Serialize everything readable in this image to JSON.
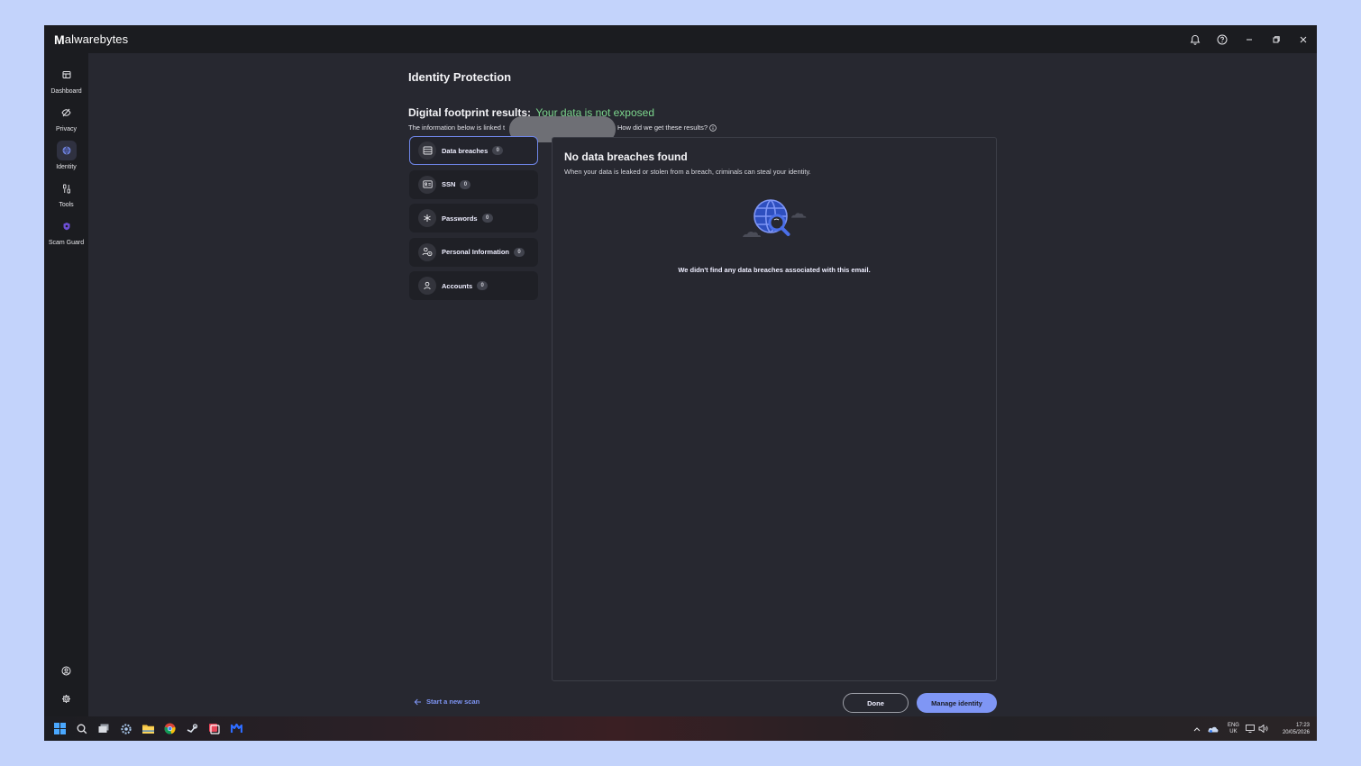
{
  "app": {
    "logo_text": "alwarebytes",
    "logo_mark": "M",
    "title_actions": [
      "bell-icon",
      "help-icon",
      "minimize-icon",
      "restore-icon",
      "close-icon"
    ]
  },
  "sidebar": {
    "items": [
      {
        "label": "Dashboard",
        "icon": "dashboard-icon"
      },
      {
        "label": "Privacy",
        "icon": "privacy-icon"
      },
      {
        "label": "Identity",
        "icon": "identity-icon",
        "active": true
      },
      {
        "label": "Tools",
        "icon": "tools-icon"
      },
      {
        "label": "Scam Guard",
        "icon": "scam-guard-icon"
      }
    ],
    "bottom": [
      "account-icon",
      "settings-icon"
    ]
  },
  "main": {
    "page_title": "Identity Protection",
    "footprint_label": "Digital footprint results:",
    "footprint_status": "Your data is not exposed",
    "linked_text": "The information below is linked t",
    "how_text": "How did we get these results?",
    "categories": [
      {
        "label": "Data breaches",
        "count": "0",
        "icon": "database-icon",
        "active": true
      },
      {
        "label": "SSN",
        "count": "0",
        "icon": "id-card-icon"
      },
      {
        "label": "Passwords",
        "count": "0",
        "icon": "asterisk-icon"
      },
      {
        "label": "Personal Information",
        "count": "0",
        "icon": "person-info-icon"
      },
      {
        "label": "Accounts",
        "count": "0",
        "icon": "user-icon"
      }
    ],
    "panel": {
      "title": "No data breaches found",
      "subtitle": "When your data is leaked or stolen from a breach, criminals can steal your identity.",
      "message": "We didn't find any data breaches associated with this email."
    },
    "start_scan": "Start a new scan",
    "done_label": "Done",
    "manage_label": "Manage identity"
  },
  "taskbar": {
    "lang_top": "ENG",
    "lang_bottom": "UK",
    "time": "17:23",
    "date": "20/05/2026"
  },
  "colors": {
    "accent": "#7f96f5",
    "success": "#7cd68d",
    "background": "#272830",
    "sidebar": "#1b1c20"
  }
}
